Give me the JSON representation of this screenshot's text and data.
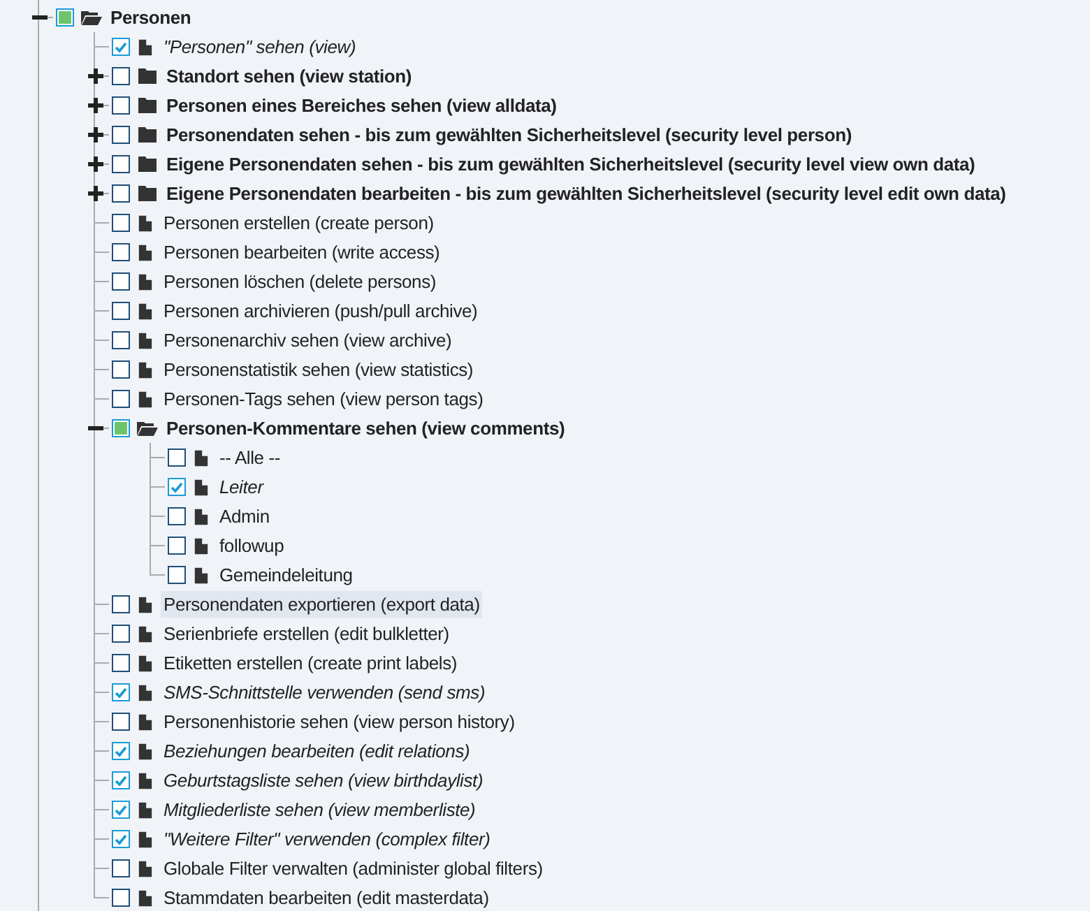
{
  "tree": [
    {
      "label": "Personen",
      "kind": "folder",
      "expanded": true,
      "checked": false,
      "partial": true,
      "selected": false,
      "children": [
        {
          "label": "\"Personen\" sehen (view)",
          "kind": "file",
          "checked": true,
          "partial": false,
          "selected": false
        },
        {
          "label": "Standort sehen (view station)",
          "kind": "folder",
          "expanded": false,
          "checked": false,
          "partial": false,
          "selected": false
        },
        {
          "label": "Personen eines Bereiches sehen (view alldata)",
          "kind": "folder",
          "expanded": false,
          "checked": false,
          "partial": false,
          "selected": false
        },
        {
          "label": "Personendaten sehen - bis zum gewählten Sicherheitslevel (security level person)",
          "kind": "folder",
          "expanded": false,
          "checked": false,
          "partial": false,
          "selected": false
        },
        {
          "label": "Eigene Personendaten sehen - bis zum gewählten Sicherheitslevel (security level view own data)",
          "kind": "folder",
          "expanded": false,
          "checked": false,
          "partial": false,
          "selected": false
        },
        {
          "label": "Eigene Personendaten bearbeiten - bis zum gewählten Sicherheitslevel (security level edit own data)",
          "kind": "folder",
          "expanded": false,
          "checked": false,
          "partial": false,
          "selected": false
        },
        {
          "label": "Personen erstellen (create person)",
          "kind": "file",
          "checked": false,
          "partial": false,
          "selected": false
        },
        {
          "label": "Personen bearbeiten (write access)",
          "kind": "file",
          "checked": false,
          "partial": false,
          "selected": false
        },
        {
          "label": "Personen löschen (delete persons)",
          "kind": "file",
          "checked": false,
          "partial": false,
          "selected": false
        },
        {
          "label": "Personen archivieren (push/pull archive)",
          "kind": "file",
          "checked": false,
          "partial": false,
          "selected": false
        },
        {
          "label": "Personenarchiv sehen (view archive)",
          "kind": "file",
          "checked": false,
          "partial": false,
          "selected": false
        },
        {
          "label": "Personenstatistik sehen (view statistics)",
          "kind": "file",
          "checked": false,
          "partial": false,
          "selected": false
        },
        {
          "label": "Personen-Tags sehen (view person tags)",
          "kind": "file",
          "checked": false,
          "partial": false,
          "selected": false
        },
        {
          "label": "Personen-Kommentare sehen (view comments)",
          "kind": "folder",
          "expanded": true,
          "checked": false,
          "partial": true,
          "selected": false,
          "children": [
            {
              "label": "-- Alle --",
              "kind": "file",
              "checked": false,
              "partial": false,
              "selected": false
            },
            {
              "label": "Leiter",
              "kind": "file",
              "checked": true,
              "partial": false,
              "selected": false
            },
            {
              "label": "Admin",
              "kind": "file",
              "checked": false,
              "partial": false,
              "selected": false
            },
            {
              "label": "followup",
              "kind": "file",
              "checked": false,
              "partial": false,
              "selected": false
            },
            {
              "label": "Gemeindeleitung",
              "kind": "file",
              "checked": false,
              "partial": false,
              "selected": false
            }
          ]
        },
        {
          "label": "Personendaten exportieren (export data)",
          "kind": "file",
          "checked": false,
          "partial": false,
          "selected": true
        },
        {
          "label": "Serienbriefe erstellen (edit bulkletter)",
          "kind": "file",
          "checked": false,
          "partial": false,
          "selected": false
        },
        {
          "label": "Etiketten erstellen (create print labels)",
          "kind": "file",
          "checked": false,
          "partial": false,
          "selected": false
        },
        {
          "label": "SMS-Schnittstelle verwenden (send sms)",
          "kind": "file",
          "checked": true,
          "partial": false,
          "selected": false
        },
        {
          "label": "Personenhistorie sehen (view person history)",
          "kind": "file",
          "checked": false,
          "partial": false,
          "selected": false
        },
        {
          "label": "Beziehungen bearbeiten (edit relations)",
          "kind": "file",
          "checked": true,
          "partial": false,
          "selected": false
        },
        {
          "label": "Geburtstagsliste sehen (view birthdaylist)",
          "kind": "file",
          "checked": true,
          "partial": false,
          "selected": false
        },
        {
          "label": "Mitgliederliste sehen (view memberliste)",
          "kind": "file",
          "checked": true,
          "partial": false,
          "selected": false
        },
        {
          "label": "\"Weitere Filter\" verwenden (complex filter)",
          "kind": "file",
          "checked": true,
          "partial": false,
          "selected": false
        },
        {
          "label": "Globale Filter verwalten (administer global filters)",
          "kind": "file",
          "checked": false,
          "partial": false,
          "selected": false
        },
        {
          "label": "Stammdaten bearbeiten (edit masterdata)",
          "kind": "file",
          "checked": false,
          "partial": false,
          "selected": false
        }
      ]
    }
  ]
}
